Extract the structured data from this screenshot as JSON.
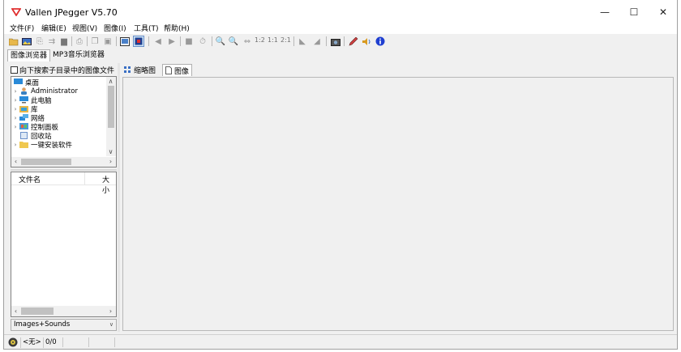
{
  "window": {
    "title": "Vallen JPegger V5.70",
    "controls": {
      "minimize": "—",
      "maximize": "☐",
      "close": "✕"
    }
  },
  "menu": [
    "文件(F)",
    "编辑(E)",
    "视图(V)",
    "图像(I)",
    "工具(T)",
    "帮助(H)"
  ],
  "toolbar": {
    "zoom_12": "1:2",
    "zoom_11": "1:1",
    "zoom_21": "2:1"
  },
  "top_tabs": [
    "图像浏览器",
    "MP3音乐浏览器"
  ],
  "left": {
    "search_subdirs_label": "向下搜索子目录中的图像文件",
    "tree": [
      "桌面",
      "Administrator",
      "此电脑",
      "库",
      "网络",
      "控制面板",
      "回收站",
      "一键安装软件"
    ],
    "file_columns": [
      "文件名",
      "大小"
    ],
    "filter_value": "Images+Sounds"
  },
  "right_tabs": [
    "缩略图",
    "图像"
  ],
  "status": {
    "field1": "<无>",
    "field2": "0/0"
  },
  "colors": {
    "accent": "#cce4f7",
    "app_icon": "#e03030"
  }
}
